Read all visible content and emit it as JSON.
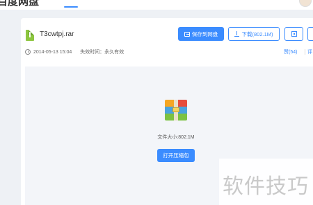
{
  "header": {
    "logo_text": "百度网盘",
    "active_nav": "",
    "avatar": "user-avatar"
  },
  "file": {
    "name": "T3cwtpj.rar",
    "icon": "zip-file-icon",
    "date": "2014-05-13 15:04",
    "expiry": "失效时间：永久有效",
    "likes": "赞(54)",
    "comment": "评"
  },
  "toolbar": {
    "save_label": "保存到网盘",
    "download_label": "下载(802.1M)",
    "qr_icon": "qr-code-icon",
    "more_icon": "more-icon"
  },
  "preview": {
    "archive_icon": "archive-icon",
    "file_size": "文件大小:802.1M",
    "open_label": "打开压缩包"
  },
  "watermark": {
    "text": "软件技巧"
  },
  "colors": {
    "accent": "#3b8cff",
    "page_bg": "#eef1f5",
    "preview_bg": "#f3f5f9"
  }
}
